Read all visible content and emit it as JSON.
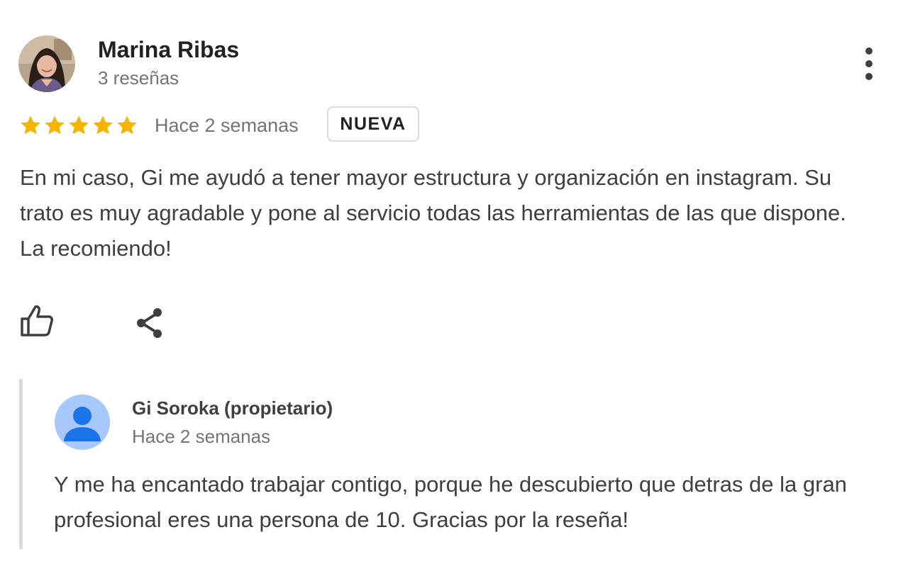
{
  "review": {
    "author": {
      "name": "Marina Ribas",
      "review_count": "3 reseñas"
    },
    "rating": 5,
    "date": "Hace 2 semanas",
    "badge": "NUEVA",
    "text": "En mi caso, Gi me ayudó a tener mayor estructura y organización en instagram. Su trato es muy agradable y pone al servicio todas las herramientas de las que dispone. La recomiendo!",
    "actions": {
      "like_icon": "thumb-up-icon",
      "share_icon": "share-icon",
      "more_icon": "more-vert-icon"
    }
  },
  "reply": {
    "owner_name": "Gi Soroka (propietario)",
    "date": "Hace 2 semanas",
    "text": "Y me ha encantado trabajar contigo, porque he descubierto que detras de la gran profesional eres una persona de 10. Gracias por la reseña!"
  },
  "colors": {
    "star": "#f4b400",
    "icon": "#5f6368",
    "avatar_bg": "#a8c7fa",
    "avatar_fg": "#1a73e8"
  }
}
